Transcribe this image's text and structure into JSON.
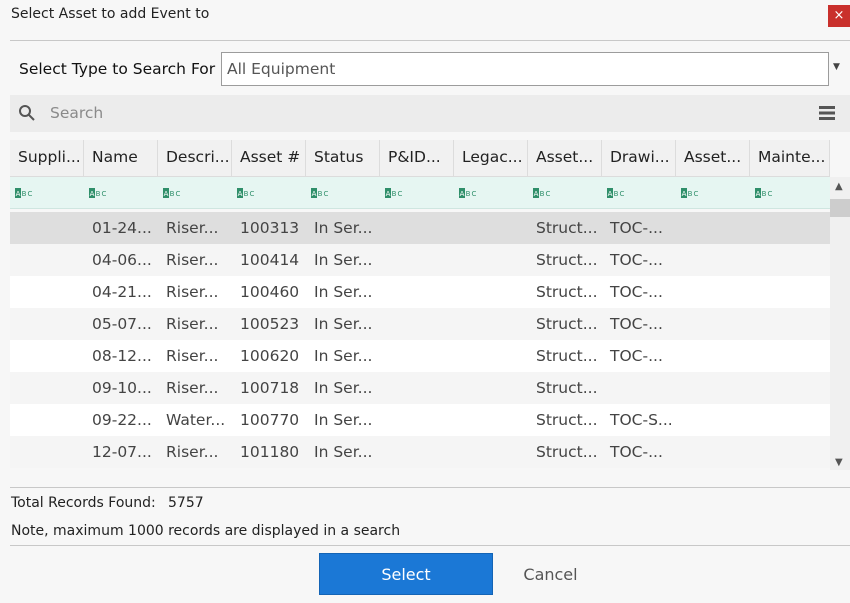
{
  "dialog": {
    "title": "Select Asset to add Event to",
    "close_label": "×"
  },
  "type_search": {
    "label": "Select Type to Search For",
    "value": "All Equipment"
  },
  "search": {
    "placeholder": "Search"
  },
  "grid": {
    "columns": [
      "Suppli...",
      "Name",
      "Descri...",
      "Asset #",
      "Status",
      "P&ID...",
      "Legac...",
      "Asset...",
      "Drawi...",
      "Asset...",
      "Mainte..."
    ],
    "filter_icon": "abc-filter-icon",
    "rows": [
      [
        "",
        "01-24...",
        "Riser...",
        "100313",
        "In Ser...",
        "",
        "",
        "Struct...",
        "TOC-...",
        "",
        ""
      ],
      [
        "",
        "04-06...",
        "Riser...",
        "100414",
        "In Ser...",
        "",
        "",
        "Struct...",
        "TOC-...",
        "",
        ""
      ],
      [
        "",
        "04-21...",
        "Riser...",
        "100460",
        "In Ser...",
        "",
        "",
        "Struct...",
        "TOC-...",
        "",
        ""
      ],
      [
        "",
        "05-07...",
        "Riser...",
        "100523",
        "In Ser...",
        "",
        "",
        "Struct...",
        "TOC-...",
        "",
        ""
      ],
      [
        "",
        "08-12...",
        "Riser...",
        "100620",
        "In Ser...",
        "",
        "",
        "Struct...",
        "TOC-...",
        "",
        ""
      ],
      [
        "",
        "09-10...",
        "Riser...",
        "100718",
        "In Ser...",
        "",
        "",
        "Struct...",
        "",
        "",
        ""
      ],
      [
        "",
        "09-22...",
        "Water...",
        "100770",
        "In Ser...",
        "",
        "",
        "Struct...",
        "TOC-S...",
        "",
        ""
      ],
      [
        "",
        "12-07...",
        "Riser...",
        "101180",
        "In Ser...",
        "",
        "",
        "Struct...",
        "TOC-...",
        "",
        ""
      ]
    ],
    "selected_row": 0
  },
  "footer": {
    "total_label": "Total Records Found:",
    "total_value": "5757",
    "note": "Note, maximum 1000 records are displayed in a search"
  },
  "buttons": {
    "select": "Select",
    "cancel": "Cancel"
  },
  "colors": {
    "accent": "#1b78d6",
    "close": "#c9302c",
    "filter_row": "#e6f6f2",
    "selected_row": "#dedede",
    "alt_row": "#f5f5f5"
  }
}
